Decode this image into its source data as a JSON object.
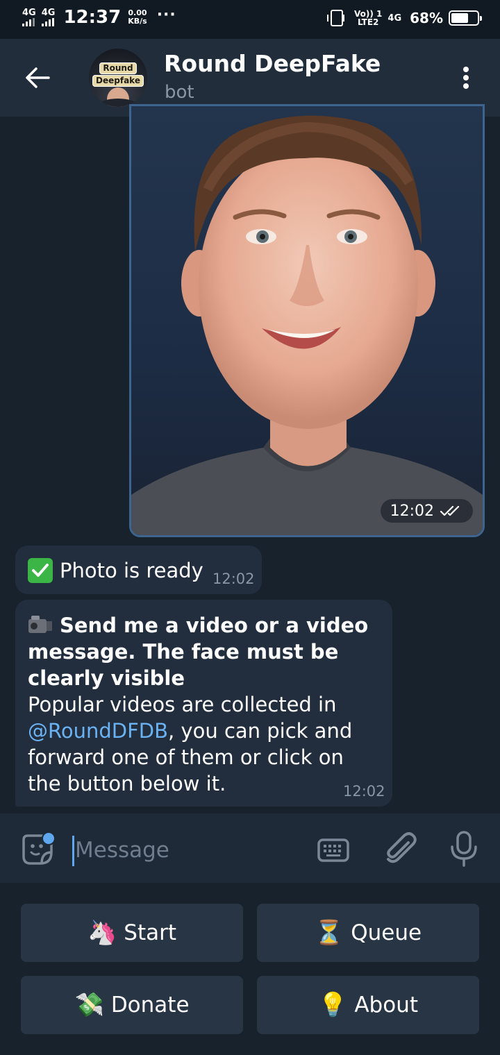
{
  "status_bar": {
    "signal1": "4G",
    "signal2": "4G",
    "time": "12:37",
    "speed_value": "0.00",
    "speed_unit": "KB/s",
    "overflow": "···",
    "volte_line1": "Vo)) 1",
    "volte_line2": "LTE2",
    "network_type": "4G",
    "battery_percent": "68%",
    "battery_level": 0.68
  },
  "header": {
    "avatar_text_line1": "Round",
    "avatar_text_line2": "Deepfake",
    "title": "Round DeepFake",
    "subtitle": "bot"
  },
  "messages": {
    "photo": {
      "time": "12:02",
      "status_icon": "double-check-icon"
    },
    "photo_ready": {
      "emoji": "check-mark-emoji",
      "text": "Photo is ready",
      "time": "12:02"
    },
    "instructions": {
      "emoji": "video-camera-emoji",
      "bold_text": "Send me a video or a video message. The face must be clearly visible",
      "text_before_mention": "Popular videos are collected in ",
      "mention": "@RoundDFDB",
      "text_after_mention": ", you can pick and forward one of them or click on the button below it.",
      "time": "12:02"
    }
  },
  "input": {
    "placeholder": "Message",
    "value": ""
  },
  "keyboard": {
    "buttons": [
      {
        "emoji": "🦄",
        "label": "Start"
      },
      {
        "emoji": "⏳",
        "label": "Queue"
      },
      {
        "emoji": "💸",
        "label": "Donate"
      },
      {
        "emoji": "💡",
        "label": "About"
      }
    ]
  },
  "colors": {
    "background": "#18222d",
    "header": "#212d3b",
    "bubble": "#222e3d",
    "accent": "#5fa8ee",
    "link": "#6ab2f2",
    "muted": "#8797a8"
  }
}
